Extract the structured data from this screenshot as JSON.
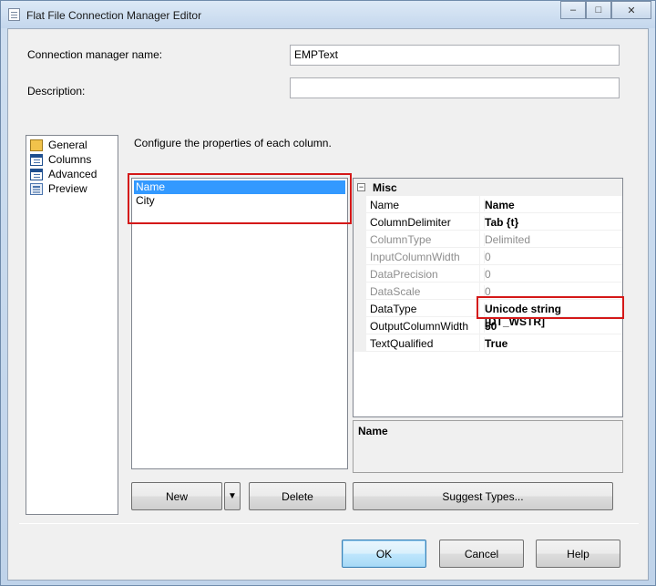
{
  "window": {
    "title": "Flat File Connection Manager Editor"
  },
  "window_controls": {
    "minimize": "–",
    "restore": "□",
    "close": "✕"
  },
  "fields": {
    "connection_manager_name_label": "Connection manager name:",
    "connection_manager_name_value": "EMPText",
    "description_label": "Description:",
    "description_value": ""
  },
  "nav": {
    "items": [
      {
        "label": "General",
        "icon": "general-page-icon"
      },
      {
        "label": "Columns",
        "icon": "columns-page-icon"
      },
      {
        "label": "Advanced",
        "icon": "advanced-page-icon"
      },
      {
        "label": "Preview",
        "icon": "preview-page-icon"
      }
    ],
    "selected": "Advanced"
  },
  "main": {
    "instruction": "Configure the properties of each column.",
    "columns": [
      {
        "label": "Name",
        "selected": true
      },
      {
        "label": "City",
        "selected": false
      }
    ]
  },
  "properties": {
    "category": "Misc",
    "category_toggle": "⊟",
    "rows": [
      {
        "name": "Name",
        "value": "Name",
        "enabled": true,
        "bold": true
      },
      {
        "name": "ColumnDelimiter",
        "value": "Tab {t}",
        "enabled": true,
        "bold": true
      },
      {
        "name": "ColumnType",
        "value": "Delimited",
        "enabled": false,
        "bold": false
      },
      {
        "name": "InputColumnWidth",
        "value": "0",
        "enabled": false,
        "bold": false
      },
      {
        "name": "DataPrecision",
        "value": "0",
        "enabled": false,
        "bold": false
      },
      {
        "name": "DataScale",
        "value": "0",
        "enabled": false,
        "bold": false
      },
      {
        "name": "DataType",
        "value": "Unicode string [DT_WSTR]",
        "enabled": true,
        "bold": true
      },
      {
        "name": "OutputColumnWidth",
        "value": "50",
        "enabled": true,
        "bold": true
      },
      {
        "name": "TextQualified",
        "value": "True",
        "enabled": true,
        "bold": true
      }
    ],
    "description_title": "Name"
  },
  "buttons": {
    "new": "New",
    "new_dropdown": "▼",
    "delete": "Delete",
    "suggest_types": "Suggest Types...",
    "ok": "OK",
    "cancel": "Cancel",
    "help": "Help"
  },
  "colors": {
    "selection": "#3399ff",
    "highlight_border": "#d41818"
  }
}
